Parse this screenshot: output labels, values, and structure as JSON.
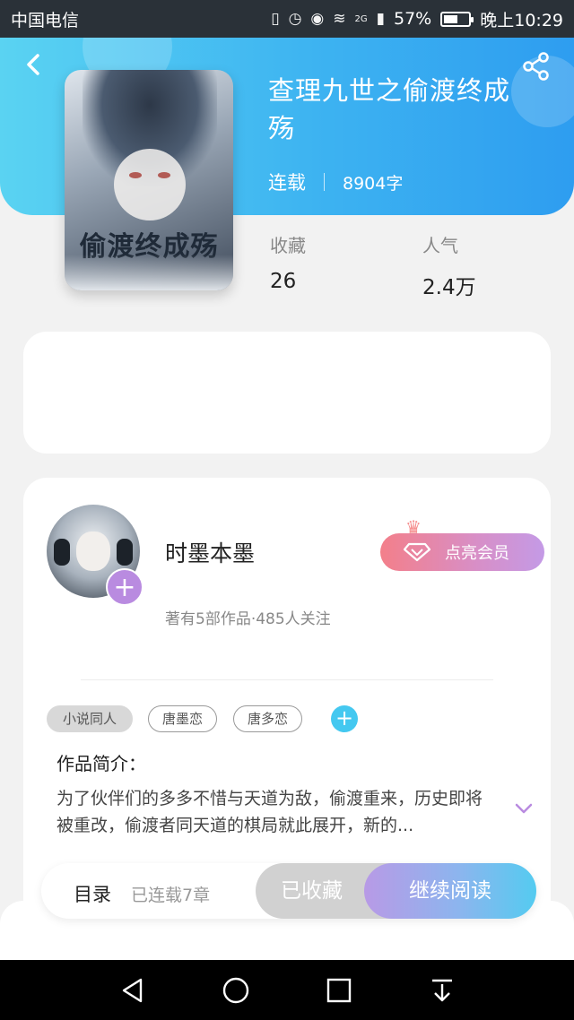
{
  "status_bar": {
    "carrier": "中国电信",
    "network": "2G",
    "battery": "57%",
    "battery_level": 0.57,
    "time": "晚上10:29"
  },
  "book": {
    "title": "查理九世之偷渡终成殇",
    "status": "连载",
    "word_count": "8904字",
    "cover_text": "偷渡终成殇",
    "stats": [
      {
        "label": "收藏",
        "value": "26"
      },
      {
        "label": "人气",
        "value": "2.4万"
      }
    ]
  },
  "author": {
    "name": "时墨本墨",
    "meta": "著有5部作品·485人关注",
    "follow_symbol": "+",
    "vip_label": "点亮会员"
  },
  "tags": [
    "小说同人",
    "唐墨恋",
    "唐多恋"
  ],
  "add_tag_symbol": "+",
  "intro": {
    "title": "作品简介：",
    "text": "为了伙伴们的多多不惜与天道为敌，偷渡重来，历史即将被重改，偷渡者同天道的棋局就此展开，新的..."
  },
  "actions": {
    "toc_label": "目录",
    "toc_count": "已连载7章",
    "collected_label": "已收藏",
    "read_label": "继续阅读"
  },
  "colors": {
    "header_start": "#5ad3f2",
    "header_end": "#2e9df0",
    "vip_start": "#f37f8a",
    "vip_end": "#c49ae6",
    "accent_purple": "#b98be0"
  }
}
